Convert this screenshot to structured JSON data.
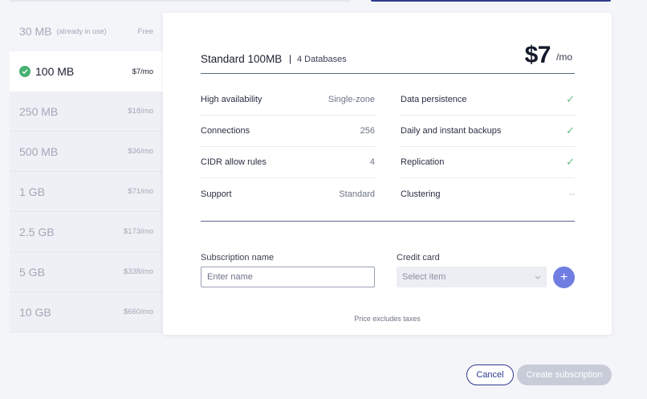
{
  "plans": [
    {
      "size": "30 MB",
      "note": "(already in use)",
      "price": "Free"
    },
    {
      "size": "100 MB",
      "note": "",
      "price": "$7/mo"
    },
    {
      "size": "250 MB",
      "note": "",
      "price": "$18/mo"
    },
    {
      "size": "500 MB",
      "note": "",
      "price": "$36/mo"
    },
    {
      "size": "1 GB",
      "note": "",
      "price": "$71/mo"
    },
    {
      "size": "2.5 GB",
      "note": "",
      "price": "$173/mo"
    },
    {
      "size": "5 GB",
      "note": "",
      "price": "$338/mo"
    },
    {
      "size": "10 GB",
      "note": "",
      "price": "$660/mo"
    }
  ],
  "selected_icon": "check-circle-icon",
  "details": {
    "title": "Standard 100MB",
    "separator": "|",
    "databases": "4 Databases",
    "price": "$7",
    "price_unit": "/mo"
  },
  "features_left": [
    {
      "label": "High availability",
      "value": "Single-zone"
    },
    {
      "label": "Connections",
      "value": "256"
    },
    {
      "label": "CIDR allow rules",
      "value": "4"
    },
    {
      "label": "Support",
      "value": "Standard"
    }
  ],
  "features_right": [
    {
      "label": "Data persistence",
      "value": "✓"
    },
    {
      "label": "Daily and instant backups",
      "value": "✓"
    },
    {
      "label": "Replication",
      "value": "✓"
    },
    {
      "label": "Clustering",
      "value": "--"
    }
  ],
  "form": {
    "name_label": "Subscription name",
    "name_placeholder": "Enter name",
    "name_value": "",
    "cc_label": "Credit card",
    "cc_placeholder": "Select item",
    "add_symbol": "+"
  },
  "tax_note": "Price excludes taxes",
  "actions": {
    "cancel": "Cancel",
    "create": "Create subscription"
  },
  "colors": {
    "accent": "#2f3a8f",
    "success": "#48b071",
    "add_button": "#6f7ee0",
    "disabled": "#c8ccd8"
  }
}
